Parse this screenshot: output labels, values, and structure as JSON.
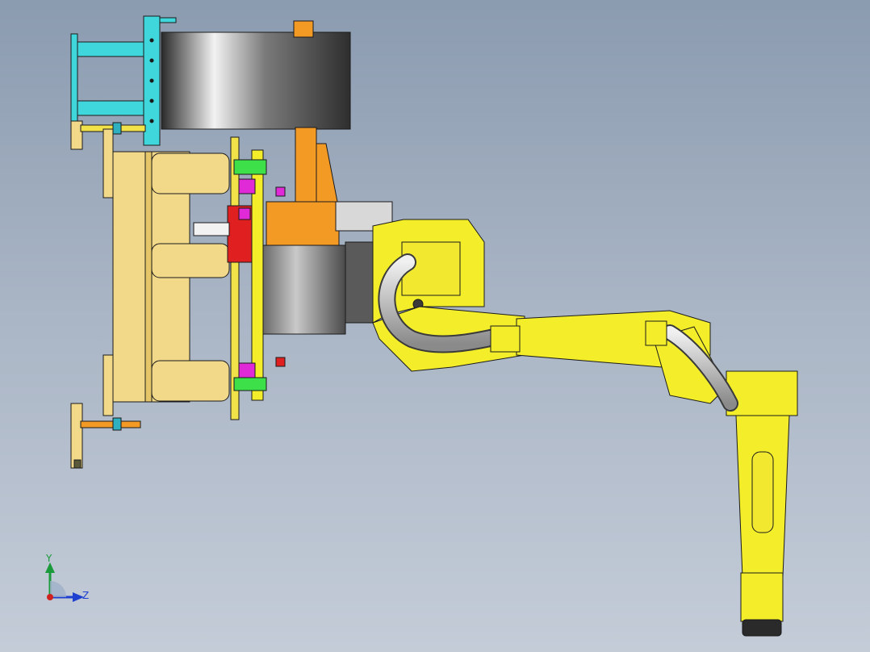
{
  "viewport": {
    "background_top": "#8b9bb0",
    "background_bottom": "#c4ccd8"
  },
  "colors": {
    "robot_yellow": "#f4ee2a",
    "fixture_tan": "#f2d98a",
    "fixture_cyan": "#3fd6dc",
    "bracket_orange": "#f39a25",
    "drum_dark": "#3a3a3a",
    "clamp_green": "#3ee04a",
    "clamp_magenta": "#e02ad8",
    "valve_red": "#e02020",
    "hose_grey": "#c8c8c8"
  },
  "triad": {
    "y_label": "Y",
    "z_label": "Z",
    "icon": "coordinate-triad-icon"
  }
}
